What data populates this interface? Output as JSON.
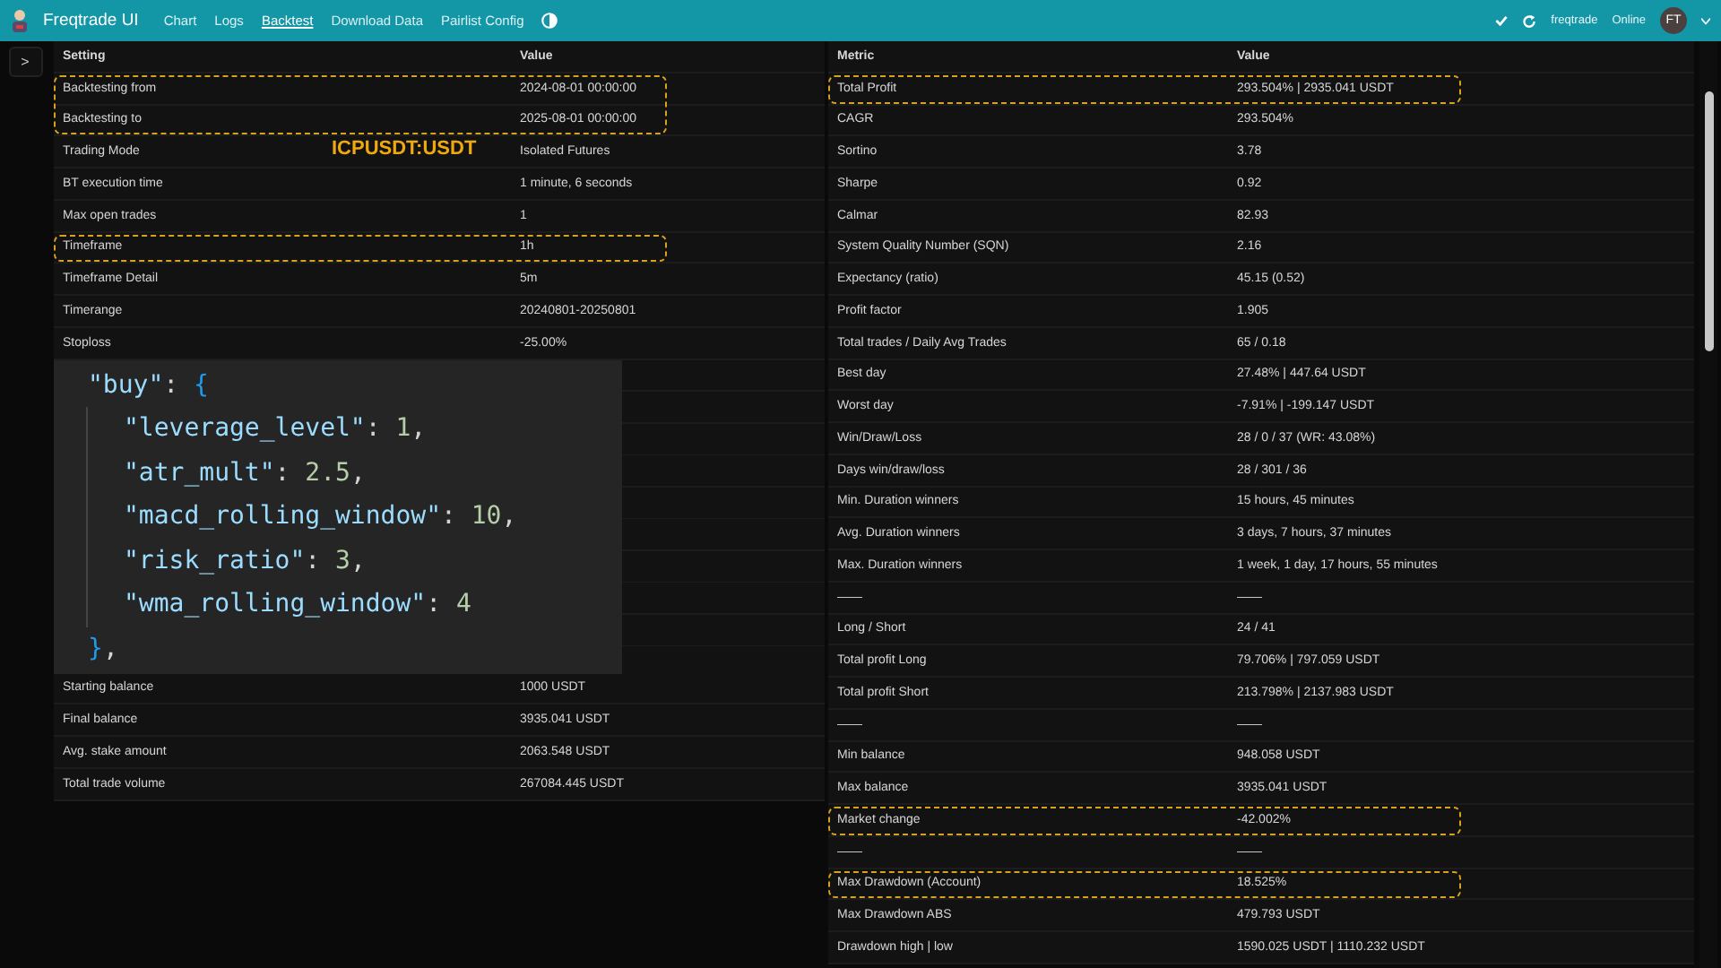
{
  "navbar": {
    "brand": "Freqtrade UI",
    "links": [
      {
        "label": "Chart",
        "selected": false
      },
      {
        "label": "Logs",
        "selected": false
      },
      {
        "label": "Backtest",
        "selected": true
      },
      {
        "label": "Download Data",
        "selected": false
      },
      {
        "label": "Pairlist Config",
        "selected": false
      }
    ],
    "bot_name": "freqtrade",
    "status": "Online",
    "avatar": "FT"
  },
  "sidebar": {
    "toggle": ">"
  },
  "settings": {
    "columns": [
      "Setting",
      "Value"
    ],
    "items": [
      {
        "kind": "group",
        "highlighted": true,
        "rows": [
          {
            "label": "Backtesting from",
            "value": "2024-08-01 00:00:00"
          },
          {
            "label": "Backtesting to",
            "value": "2025-08-01 00:00:00"
          }
        ]
      },
      {
        "kind": "row",
        "label": "Trading Mode",
        "value": "Isolated Futures",
        "annotation": "ICPUSDT:USDT"
      },
      {
        "kind": "row",
        "label": "BT execution time",
        "value": "1 minute, 6 seconds"
      },
      {
        "kind": "row",
        "label": "Max open trades",
        "value": "1"
      },
      {
        "kind": "group",
        "highlighted": true,
        "rows": [
          {
            "label": "Timeframe",
            "value": "1h"
          }
        ]
      },
      {
        "kind": "row",
        "label": "Timeframe Detail",
        "value": "5m"
      },
      {
        "kind": "row",
        "label": "Timerange",
        "value": "20240801-20250801"
      },
      {
        "kind": "row",
        "label": "Stoploss",
        "value": "-25.00%"
      },
      {
        "kind": "code",
        "lines": [
          {
            "nested": false,
            "tokens": [
              {
                "kind": "key",
                "text": "\"buy\""
              },
              {
                "kind": "punct",
                "text": ": "
              },
              {
                "kind": "brace",
                "text": "{"
              }
            ]
          },
          {
            "nested": true,
            "tokens": [
              {
                "kind": "key",
                "text": "\"leverage_level\""
              },
              {
                "kind": "punct",
                "text": ": "
              },
              {
                "kind": "number",
                "text": "1"
              },
              {
                "kind": "punct",
                "text": ","
              }
            ]
          },
          {
            "nested": true,
            "tokens": [
              {
                "kind": "key",
                "text": "\"atr_mult\""
              },
              {
                "kind": "punct",
                "text": ": "
              },
              {
                "kind": "number",
                "text": "2.5"
              },
              {
                "kind": "punct",
                "text": ","
              }
            ]
          },
          {
            "nested": true,
            "tokens": [
              {
                "kind": "key",
                "text": "\"macd_rolling_window\""
              },
              {
                "kind": "punct",
                "text": ": "
              },
              {
                "kind": "number",
                "text": "10"
              },
              {
                "kind": "punct",
                "text": ","
              }
            ]
          },
          {
            "nested": true,
            "tokens": [
              {
                "kind": "key",
                "text": "\"risk_ratio\""
              },
              {
                "kind": "punct",
                "text": ": "
              },
              {
                "kind": "number",
                "text": "3"
              },
              {
                "kind": "punct",
                "text": ","
              }
            ]
          },
          {
            "nested": true,
            "tokens": [
              {
                "kind": "key",
                "text": "\"wma_rolling_window\""
              },
              {
                "kind": "punct",
                "text": ": "
              },
              {
                "kind": "number",
                "text": "4"
              }
            ]
          },
          {
            "nested": false,
            "tokens": [
              {
                "kind": "brace",
                "text": "}"
              },
              {
                "kind": "punct",
                "text": ","
              }
            ]
          }
        ]
      },
      {
        "kind": "row",
        "label": "Starting balance",
        "value": "1000 USDT"
      },
      {
        "kind": "row",
        "label": "Final balance",
        "value": "3935.041 USDT"
      },
      {
        "kind": "row",
        "label": "Avg. stake amount",
        "value": "2063.548 USDT"
      },
      {
        "kind": "row",
        "label": "Total trade volume",
        "value": "267084.445 USDT"
      }
    ]
  },
  "metrics": {
    "columns": [
      "Metric",
      "Value"
    ],
    "items": [
      {
        "kind": "group",
        "highlighted": true,
        "rows": [
          {
            "label": "Total Profit",
            "value": "293.504% | 2935.041 USDT"
          }
        ]
      },
      {
        "kind": "row",
        "label": "CAGR",
        "value": "293.504%"
      },
      {
        "kind": "row",
        "label": "Sortino",
        "value": "3.78"
      },
      {
        "kind": "row",
        "label": "Sharpe",
        "value": "0.92"
      },
      {
        "kind": "row",
        "label": "Calmar",
        "value": "82.93"
      },
      {
        "kind": "row",
        "label": "System Quality Number (SQN)",
        "value": "2.16"
      },
      {
        "kind": "row",
        "label": "Expectancy (ratio)",
        "value": "45.15 (0.52)"
      },
      {
        "kind": "row",
        "label": "Profit factor",
        "value": "1.905"
      },
      {
        "kind": "row",
        "label": "Total trades / Daily Avg Trades",
        "value": "65 / 0.18"
      },
      {
        "kind": "row",
        "label": "Best day",
        "value": "27.48% | 447.64 USDT"
      },
      {
        "kind": "row",
        "label": "Worst day",
        "value": "-7.91% | -199.147 USDT"
      },
      {
        "kind": "row",
        "label": "Win/Draw/Loss",
        "value": "28 / 0 / 37 (WR: 43.08%)"
      },
      {
        "kind": "row",
        "label": "Days win/draw/loss",
        "value": "28 / 301 / 36"
      },
      {
        "kind": "row",
        "label": "Min. Duration winners",
        "value": "15 hours, 45 minutes"
      },
      {
        "kind": "row",
        "label": "Avg. Duration winners",
        "value": "3 days, 7 hours, 37 minutes"
      },
      {
        "kind": "row",
        "label": "Max. Duration winners",
        "value": "1 week, 1 day, 17 hours, 55 minutes"
      },
      {
        "kind": "row",
        "label": "——",
        "value": "——"
      },
      {
        "kind": "row",
        "label": "Long / Short",
        "value": "24 / 41"
      },
      {
        "kind": "row",
        "label": "Total profit Long",
        "value": "79.706% | 797.059 USDT"
      },
      {
        "kind": "row",
        "label": "Total profit Short",
        "value": "213.798% | 2137.983 USDT"
      },
      {
        "kind": "row",
        "label": "——",
        "value": "——"
      },
      {
        "kind": "row",
        "label": "Min balance",
        "value": "948.058 USDT"
      },
      {
        "kind": "row",
        "label": "Max balance",
        "value": "3935.041 USDT"
      },
      {
        "kind": "group",
        "highlighted": true,
        "rows": [
          {
            "label": "Market change",
            "value": "-42.002%"
          }
        ]
      },
      {
        "kind": "row",
        "label": "——",
        "value": "——"
      },
      {
        "kind": "group",
        "highlighted": true,
        "rows": [
          {
            "label": "Max Drawdown (Account)",
            "value": "18.525%"
          }
        ]
      },
      {
        "kind": "row",
        "label": "Max Drawdown ABS",
        "value": "479.793 USDT"
      },
      {
        "kind": "row",
        "label": "Drawdown high | low",
        "value": "1590.025 USDT | 1110.232 USDT"
      }
    ]
  }
}
